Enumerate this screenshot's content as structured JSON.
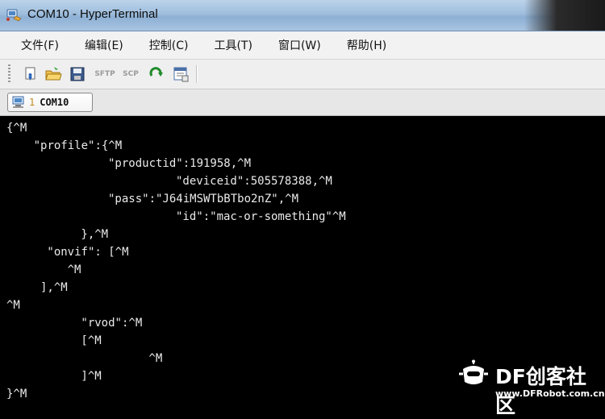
{
  "window": {
    "title": "COM10 - HyperTerminal"
  },
  "menu": [
    "文件(F)",
    "编辑(E)",
    "控制(C)",
    "工具(T)",
    "窗口(W)",
    "帮助(H)"
  ],
  "toolbar": {
    "sftp_label": "SFTP",
    "scp_label": "SCP"
  },
  "session_tab": {
    "number": "1",
    "label": "COM10"
  },
  "terminal": {
    "lines": [
      {
        "indent": 1,
        "text": "{^M"
      },
      {
        "indent": 5,
        "text": "\"profile\":{^M"
      },
      {
        "indent": 16,
        "text": "\"productid\":191958,^M"
      },
      {
        "indent": 26,
        "text": "\"deviceid\":505578388,^M"
      },
      {
        "indent": 16,
        "text": "\"pass\":\"J64iMSWTbBTbo2nZ\",^M"
      },
      {
        "indent": 26,
        "text": "\"id\":\"mac-or-something\"^M"
      },
      {
        "indent": 12,
        "text": "},^M"
      },
      {
        "indent": 7,
        "text": "\"onvif\": [^M"
      },
      {
        "indent": 10,
        "text": "^M"
      },
      {
        "indent": 6,
        "text": "],^M"
      },
      {
        "indent": 1,
        "text": "^M"
      },
      {
        "indent": 12,
        "text": "\"rvod\":^M"
      },
      {
        "indent": 12,
        "text": "[^M"
      },
      {
        "indent": 22,
        "text": "^M"
      },
      {
        "indent": 12,
        "text": "]^M"
      },
      {
        "indent": 1,
        "text": "}^M"
      }
    ]
  },
  "watermark": {
    "title": "DF创客社区",
    "url": "www.DFRobot.com.cn"
  },
  "colors": {
    "terminal_bg": "#000000",
    "terminal_fg": "#eaeaea",
    "menu_bg": "#f2f2f2"
  }
}
